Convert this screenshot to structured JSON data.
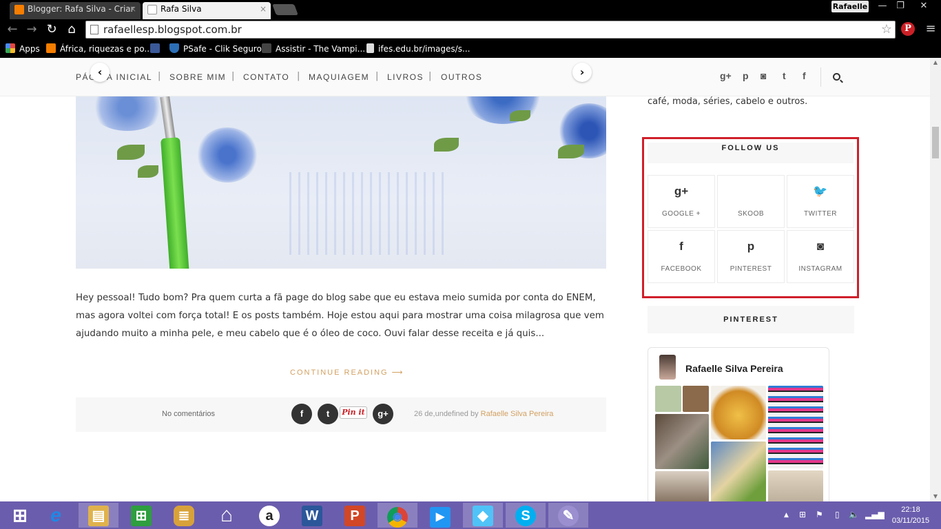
{
  "browser": {
    "tabs": [
      {
        "title": "Blogger: Rafa Silva - Criar",
        "close": "×"
      },
      {
        "title": "Rafa Silva",
        "close": "×"
      }
    ],
    "profile_name": "Rafaelle",
    "window_controls": {
      "minimize": "—",
      "restore": "❐",
      "close": "✕"
    },
    "nav": {
      "back": "←",
      "forward": "→",
      "reload": "↻",
      "home": "⌂"
    },
    "url": "rafaellesp.blogspot.com.br",
    "bookmark_star": "☆",
    "extension_pinterest": "P",
    "menu": "≡",
    "bookmarks": [
      {
        "label": "Apps",
        "icon": "apps-grid-icon",
        "color": "#e8453c"
      },
      {
        "label": "África, riquezas e po...",
        "icon": "blogger-icon",
        "color": "#f57d00"
      },
      {
        "label": "",
        "icon": "facebook-icon",
        "color": "#3b5998"
      },
      {
        "label": "PSafe - Clik Seguro",
        "icon": "psafe-shield-icon",
        "color": "#2c6fb7"
      },
      {
        "label": "Assistir - The Vampi...",
        "icon": "vampire-diaries-icon",
        "color": "#444"
      },
      {
        "label": "ifes.edu.br/images/s...",
        "icon": "page-icon",
        "color": "#ddd"
      }
    ]
  },
  "blog_nav": {
    "menu": [
      "PÁGINA INICIAL",
      "SOBRE MIM",
      "CONTATO",
      "MAQUIAGEM",
      "LIVROS",
      "OUTROS"
    ],
    "separator": "|",
    "carousel_prev": "‹",
    "carousel_next": "›",
    "social": [
      {
        "name": "google-plus-icon",
        "glyph": "g+"
      },
      {
        "name": "pinterest-icon",
        "glyph": "p"
      },
      {
        "name": "instagram-icon",
        "glyph": "◙"
      },
      {
        "name": "twitter-icon",
        "glyph": "t"
      },
      {
        "name": "facebook-icon",
        "glyph": "f"
      }
    ]
  },
  "post": {
    "excerpt": "Hey pessoal! Tudo bom? Pra quem curta a fã page do blog sabe que eu estava meio sumida por conta do ENEM, mas agora voltei com força total! E os posts também. Hoje estou aqui para mostrar uma coisa milagrosa que vem ajudando muito a minha pele, e meu cabelo que é o óleo de coco. Ouvi falar desse receita e já quis...",
    "continue_reading": "CONTINUE READING ⟶",
    "comments": "No comentários",
    "share": {
      "facebook": "f",
      "twitter": "t",
      "pinit": "Pin it",
      "googleplus": "g+"
    },
    "meta_prefix": "26 de,undefined by ",
    "author": "Rafaelle Silva Pereira"
  },
  "sidebar": {
    "about_tail": "café, moda, séries, cabelo e outros.",
    "follow_title": "FOLLOW US",
    "follow_items": [
      {
        "label": "GOOGLE +",
        "glyph": "g+"
      },
      {
        "label": "SKOOB",
        "glyph": ""
      },
      {
        "label": "TWITTER",
        "glyph": "🐦"
      },
      {
        "label": "FACEBOOK",
        "glyph": "f"
      },
      {
        "label": "PINTEREST",
        "glyph": "p"
      },
      {
        "label": "INSTAGRAM",
        "glyph": "◙"
      }
    ],
    "pinterest_title": "PINTEREST",
    "pinterest_user": "Rafaelle Silva Pereira"
  },
  "taskbar": {
    "apps": [
      {
        "name": "start-button",
        "glyph": "⊞",
        "color": "#6b5dad"
      },
      {
        "name": "internet-explorer-icon",
        "glyph": "e",
        "color": "#1e88e5"
      },
      {
        "name": "file-explorer-icon",
        "glyph": "▤",
        "color": "#e0b24c"
      },
      {
        "name": "store-icon",
        "glyph": "⊞",
        "color": "#2e9e3f"
      },
      {
        "name": "notes-icon",
        "glyph": "≣",
        "color": "#d8a23a"
      },
      {
        "name": "home-icon",
        "glyph": "⌂",
        "color": "#ffffff"
      },
      {
        "name": "amazon-icon",
        "glyph": "a",
        "color": "#222222"
      },
      {
        "name": "word-icon",
        "glyph": "W",
        "color": "#2b579a"
      },
      {
        "name": "powerpoint-icon",
        "glyph": "P",
        "color": "#d24726"
      },
      {
        "name": "chrome-icon",
        "glyph": "◉",
        "color": "#4caf50"
      },
      {
        "name": "video-icon",
        "glyph": "▶",
        "color": "#2196f3"
      },
      {
        "name": "maps-icon",
        "glyph": "◆",
        "color": "#4fc3f7"
      },
      {
        "name": "skype-icon",
        "glyph": "S",
        "color": "#00aff0"
      },
      {
        "name": "paint-icon",
        "glyph": "✎",
        "color": "#9b8fd0"
      }
    ],
    "time": "22:18",
    "date": "03/11/2015"
  }
}
